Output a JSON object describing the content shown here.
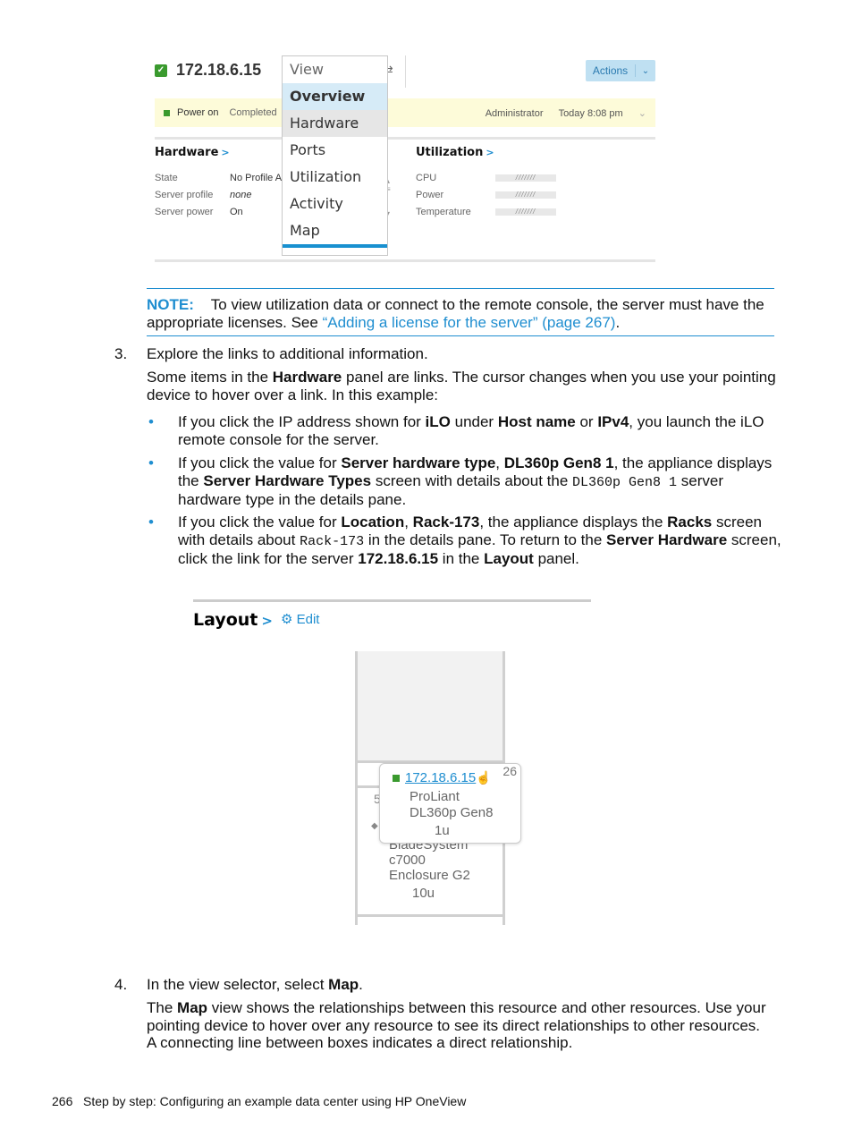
{
  "screenshot_overview": {
    "title": "172.18.6.15",
    "actions_label": "Actions",
    "status": {
      "power": "Power on",
      "state": "Completed",
      "user": "Administrator",
      "time": "Today 8:08 pm"
    },
    "view_menu": {
      "label": "View",
      "items": [
        "Overview",
        "Hardware",
        "Ports",
        "Utilization",
        "Activity",
        "Map"
      ],
      "selected": "Overview",
      "hovered": "Hardware"
    },
    "hardware_panel": {
      "title": "Hardware",
      "rows": [
        {
          "key": "State",
          "value": "No Profile A"
        },
        {
          "key": "Server profile",
          "value": "none"
        },
        {
          "key": "Server power",
          "value": "On"
        }
      ]
    },
    "utilization_panel": {
      "title": "Utilization",
      "rows": [
        {
          "key": "CPU",
          "value": "///////"
        },
        {
          "key": "Power",
          "value": "///////"
        },
        {
          "key": "Temperature",
          "value": "///////"
        }
      ]
    }
  },
  "note": {
    "label": "NOTE:",
    "text1": "To view utilization data or connect to the remote console, the server must have the",
    "text2": "appropriate licenses. See ",
    "link": "“Adding a license for the server” (page 267)",
    "end": "."
  },
  "step3": {
    "num": "3.",
    "heading": "Explore the links to additional information.",
    "p1a": "Some items in the ",
    "p1b": "Hardware",
    "p1c": " panel are links. The cursor changes when you use your pointing",
    "p2": "device to hover over a link. In this example:",
    "bullets": [
      {
        "l1": [
          "If you click the IP address shown for ",
          "iLO",
          " under ",
          "Host name",
          " or ",
          "IPv4",
          ", you launch the iLO"
        ],
        "l2": "remote console for the server."
      },
      {
        "l1": [
          "If you click the value for ",
          "Server hardware type",
          ", ",
          "DL360p Gen8 1",
          ", the appliance displays"
        ],
        "l2": [
          "the ",
          "Server Hardware Types",
          " screen with details about the ",
          "DL360p Gen8 1",
          " server"
        ],
        "l3": "hardware type in the details pane."
      },
      {
        "l1": [
          "If you click the value for ",
          "Location",
          ", ",
          "Rack-173",
          ", the appliance displays the ",
          "Racks",
          " screen"
        ],
        "l2": [
          "with details about ",
          "Rack-173",
          " in the details pane. To return to the ",
          "Server Hardware",
          " screen,"
        ],
        "l3": [
          "click the link for the server ",
          "172.18.6.15",
          " in the ",
          "Layout",
          " panel."
        ]
      }
    ]
  },
  "screenshot_layout": {
    "title": "Layout",
    "edit_label": "Edit",
    "server": {
      "ip": "172.18.6.15",
      "slot": "26",
      "model1": "ProLiant",
      "model2": "DL360p Gen8",
      "size": "1u"
    },
    "partial_slot": "5",
    "enclosure": {
      "l1": "BladeSystem",
      "l2": "c7000",
      "l3": "Enclosure G2",
      "size": "10u"
    }
  },
  "step4": {
    "num": "4.",
    "heading_a": "In the view selector, select ",
    "heading_b": "Map",
    "heading_c": ".",
    "p1a": "The ",
    "p1b": "Map",
    "p1c": " view shows the relationships between this resource and other resources. Use your",
    "p2": "pointing device to hover over any resource to see its direct relationships to other resources.",
    "p3": "A connecting line between boxes indicates a direct relationship."
  },
  "footer": {
    "page": "266",
    "text": "Step by step: Configuring an example data center using HP OneView"
  }
}
